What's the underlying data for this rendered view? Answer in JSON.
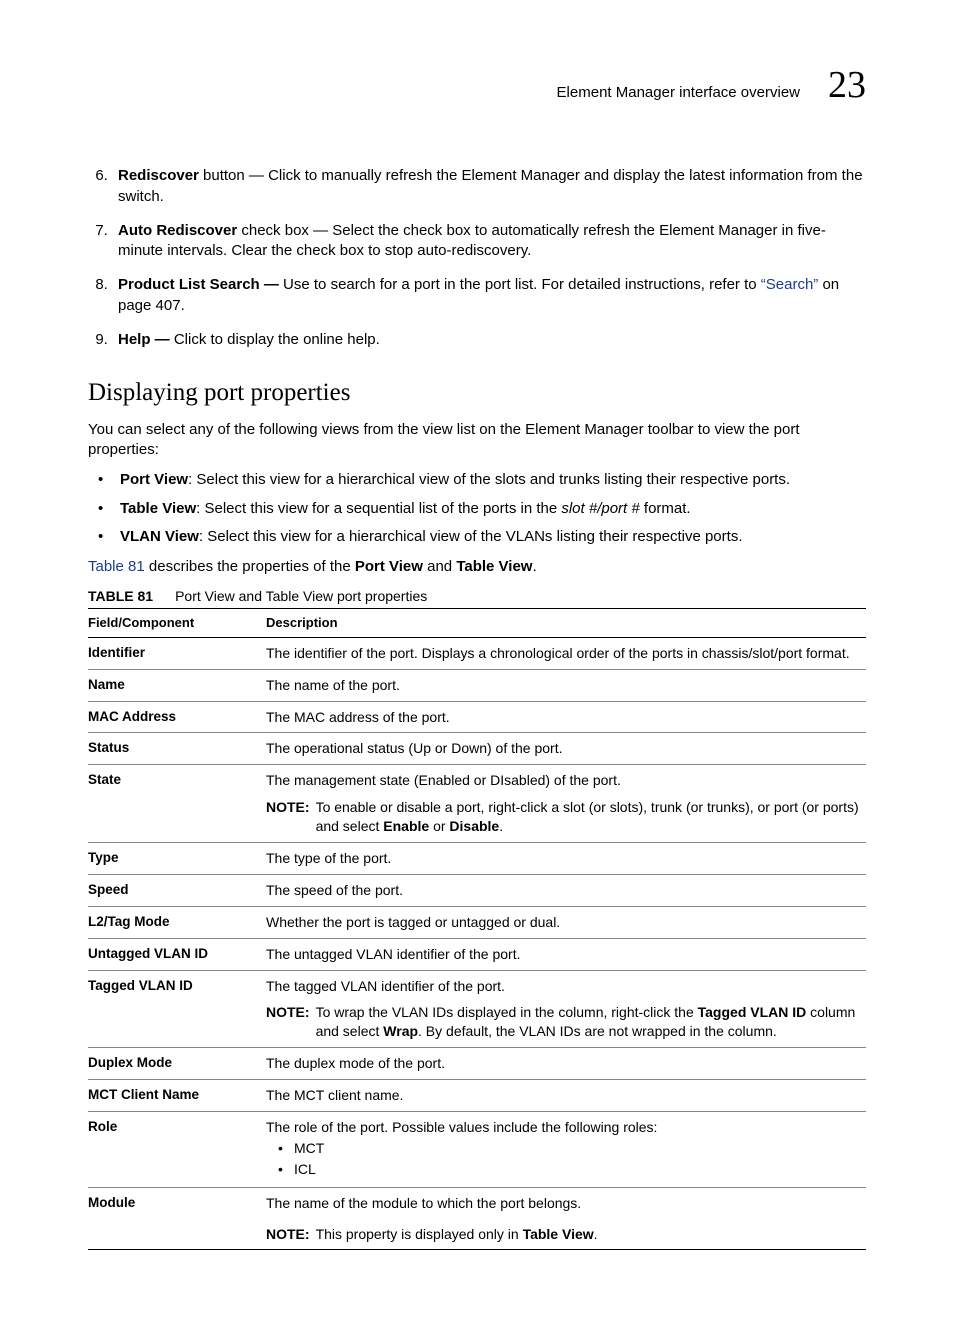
{
  "header": {
    "title": "Element Manager interface overview",
    "chapnum": "23"
  },
  "numbered": [
    {
      "n": "6",
      "bold": "Rediscover",
      "rest": " button — Click to manually refresh the Element Manager and display the latest information from the switch."
    },
    {
      "n": "7",
      "bold": "Auto Rediscover",
      "rest": " check box — Select the check box to automatically refresh the Element Manager in five-minute intervals. Clear the check box to stop auto-rediscovery."
    },
    {
      "n": "8",
      "bold": "Product List Search — ",
      "rest_pre": "Use to search for a port in the port list. For detailed instructions, refer to ",
      "link": "“Search”",
      "rest_post": " on page 407."
    },
    {
      "n": "9",
      "bold": "Help — ",
      "rest": "Click to display the online help."
    }
  ],
  "section_title": "Displaying port properties",
  "section_intro": "You can select any of the following views from the view list on the Element Manager toolbar to view the port properties:",
  "views": [
    {
      "label": "Port View",
      "text": ": Select this view for a hierarchical view of the slots and trunks listing their respective ports."
    },
    {
      "label": "Table View",
      "text_pre": ": Select this view for a sequential list of the ports in the ",
      "italic": "slot #/port #",
      "text_post": " format."
    },
    {
      "label": "VLAN View",
      "text": ": Select this view for a hierarchical view of the VLANs listing their respective ports."
    }
  ],
  "tabledesc": {
    "link": "Table 81",
    "rest": " describes the properties of the ",
    "b1": "Port View",
    "mid": " and ",
    "b2": "Table View",
    "end": "."
  },
  "table_caption": {
    "label": "TABLE 81",
    "title": "Port View and Table View port properties"
  },
  "th": {
    "c1": "Field/Component",
    "c2": "Description"
  },
  "rows": {
    "identifier": {
      "f": "Identifier",
      "d": "The identifier of the port. Displays a chronological order of the ports in chassis/slot/port format."
    },
    "name": {
      "f": "Name",
      "d": "The name of the port."
    },
    "mac": {
      "f": "MAC Address",
      "d": "The MAC address of the port."
    },
    "status": {
      "f": "Status",
      "d": "The operational status (Up or Down) of the port."
    },
    "state": {
      "f": "State",
      "d": "The management state (Enabled or DIsabled) of the port.",
      "note_label": "NOTE:",
      "note_pre": "To enable or disable a port, right-click a slot (or slots), trunk (or trunks), or port (or ports) and select ",
      "note_b1": "Enable",
      "note_mid": " or ",
      "note_b2": "Disable",
      "note_post": "."
    },
    "type": {
      "f": "Type",
      "d": "The type of the port."
    },
    "speed": {
      "f": "Speed",
      "d": "The speed of the port."
    },
    "l2": {
      "f": "L2/Tag Mode",
      "d": "Whether the port is tagged or untagged or dual."
    },
    "untagged": {
      "f": "Untagged VLAN ID",
      "d": "The untagged VLAN identifier of the port."
    },
    "tagged": {
      "f": "Tagged VLAN ID",
      "d": "The tagged VLAN identifier of the port.",
      "note_label": "NOTE:",
      "note_pre": "To wrap the VLAN IDs displayed in the column, right-click the ",
      "note_b1": "Tagged VLAN ID",
      "note_mid": " column and select ",
      "note_b2": "Wrap",
      "note_post": ". By default, the VLAN IDs are not wrapped in the column."
    },
    "duplex": {
      "f": "Duplex Mode",
      "d": "The duplex mode of the port."
    },
    "mct": {
      "f": "MCT Client Name",
      "d": "The MCT client name."
    },
    "role": {
      "f": "Role",
      "d": "The role of the port. Possible values include the following roles:",
      "sub": [
        "MCT",
        "ICL"
      ]
    },
    "module": {
      "f": "Module",
      "d": "The name of the module to which the port belongs.",
      "note_label": "NOTE:",
      "note_pre": "This property is displayed only in ",
      "note_b1": "Table View",
      "note_post": "."
    }
  }
}
